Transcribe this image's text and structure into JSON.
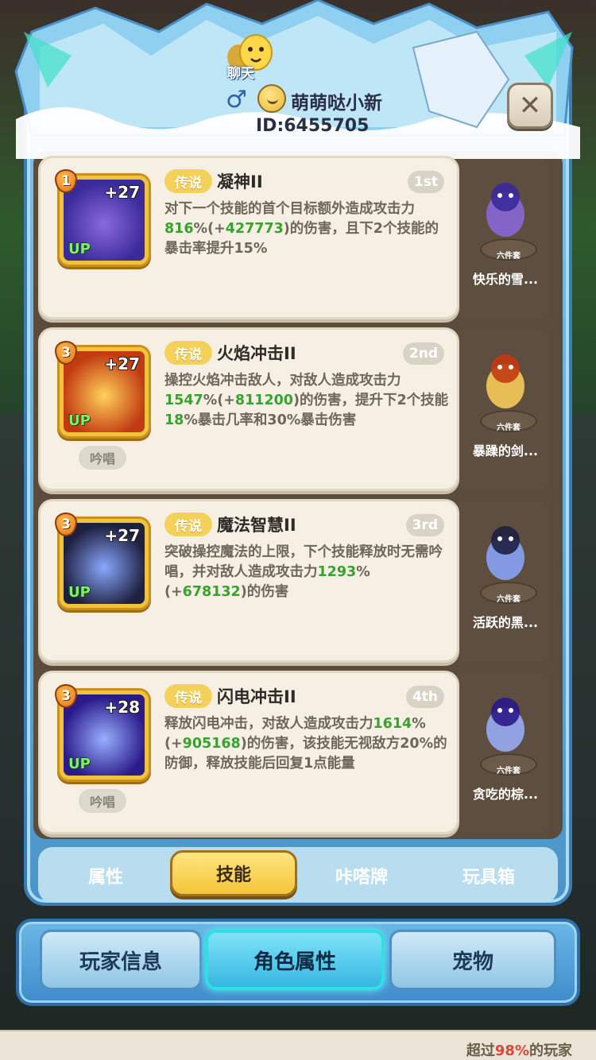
{
  "header": {
    "chat_label": "聊天",
    "gender_symbol": "♂",
    "player_name": "萌萌哒小新",
    "player_id": "ID:6455705",
    "close_symbol": "✕"
  },
  "skills": [
    {
      "level": "1",
      "plus": "+27",
      "up": "UP",
      "tag": "传说",
      "name": "凝神II",
      "rank": "1st",
      "chant": "",
      "desc_parts": [
        {
          "t": "对下一个技能的首个目标额外造成攻击力",
          "c": ""
        },
        {
          "t": "816",
          "c": "g"
        },
        {
          "t": "%(+",
          "c": ""
        },
        {
          "t": "427773",
          "c": "g"
        },
        {
          "t": ")的伤害，且下2个技能的暴击率提升15%",
          "c": ""
        }
      ],
      "figure": {
        "tag": "六件套",
        "name": "快乐的雪..."
      },
      "icon_colors": [
        "#3a2a9a",
        "#8a6ae0"
      ]
    },
    {
      "level": "3",
      "plus": "+27",
      "up": "UP",
      "tag": "传说",
      "name": "火焰冲击II",
      "rank": "2nd",
      "chant": "吟唱",
      "desc_parts": [
        {
          "t": "操控火焰冲击敌人，对敌人造成攻击力",
          "c": ""
        },
        {
          "t": "1547",
          "c": "g"
        },
        {
          "t": "%(+",
          "c": ""
        },
        {
          "t": "811200",
          "c": "g"
        },
        {
          "t": ")的伤害，提升下2个技能",
          "c": ""
        },
        {
          "t": "18",
          "c": "g"
        },
        {
          "t": "%暴击几率和30%暴击伤害",
          "c": ""
        }
      ],
      "figure": {
        "tag": "六件套",
        "name": "暴躁的剑..."
      },
      "icon_colors": [
        "#c23a12",
        "#ffd25a"
      ]
    },
    {
      "level": "3",
      "plus": "+27",
      "up": "UP",
      "tag": "传说",
      "name": "魔法智慧II",
      "rank": "3rd",
      "chant": "",
      "desc_parts": [
        {
          "t": "突破操控魔法的上限，下个技能释放时无需吟唱，并对敌人造成攻击力",
          "c": ""
        },
        {
          "t": "1293",
          "c": "g"
        },
        {
          "t": "%(+",
          "c": ""
        },
        {
          "t": "678132",
          "c": "g"
        },
        {
          "t": ")的伤害",
          "c": ""
        }
      ],
      "figure": {
        "tag": "六件套",
        "name": "活跃的黑..."
      },
      "icon_colors": [
        "#1e2040",
        "#8aa8ff"
      ]
    },
    {
      "level": "3",
      "plus": "+28",
      "up": "UP",
      "tag": "传说",
      "name": "闪电冲击II",
      "rank": "4th",
      "chant": "吟唱",
      "desc_parts": [
        {
          "t": "释放闪电冲击，对敌人造成攻击力",
          "c": ""
        },
        {
          "t": "1614",
          "c": "g"
        },
        {
          "t": "%(+",
          "c": ""
        },
        {
          "t": "905168",
          "c": "g"
        },
        {
          "t": ")的伤害，该技能无视敌方20%的防御，释放技能后回复1点能量",
          "c": ""
        }
      ],
      "figure": {
        "tag": "六件套",
        "name": "贪吃的棕..."
      },
      "icon_colors": [
        "#2a1a8a",
        "#9ab0ff"
      ]
    }
  ],
  "subtabs": [
    "属性",
    "技能",
    "咔嗒牌",
    "玩具箱"
  ],
  "bottom_tabs": [
    "玩家信息",
    "角色属性",
    "宠物"
  ],
  "rank_text": {
    "prefix": "超过",
    "percent": "98%",
    "suffix": "的玩家"
  },
  "colors": {
    "green_value": "#3aa030",
    "legend_tag": "#f4d15a",
    "active_subtab": "#f3c53a",
    "frame_blue": "#5ea9d8"
  }
}
